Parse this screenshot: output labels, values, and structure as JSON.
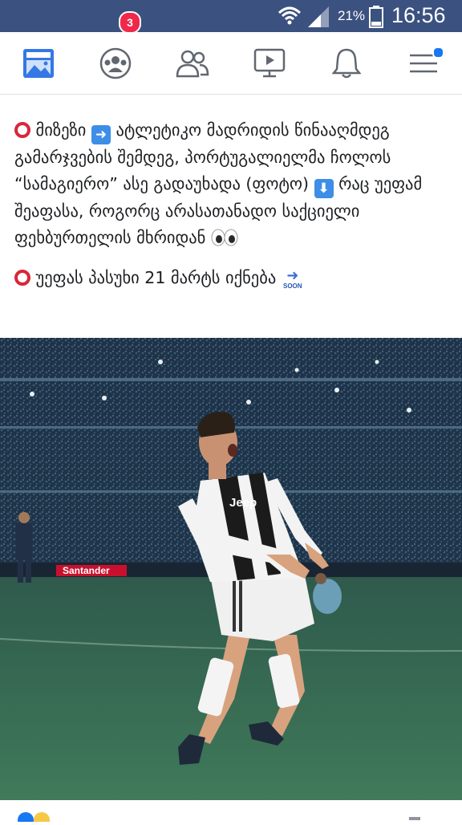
{
  "status_bar": {
    "battery": "21%",
    "time": "16:56"
  },
  "nav": {
    "items": [
      {
        "name": "news-feed"
      },
      {
        "name": "groups",
        "badge": "3"
      },
      {
        "name": "friends"
      },
      {
        "name": "watch"
      },
      {
        "name": "notifications"
      },
      {
        "name": "menu"
      }
    ]
  },
  "post": {
    "line1_a": "მიზეზი",
    "line1_b": "ატლეტიკო მადრიდის წინააღმდეგ გამარჯვების შემდეგ, პორტუგალიელმა ჩოლოს “სამაგიერო” ასე გადაუხადა (ფოტო)",
    "line1_c": "რაც უეფამ შეაფასა, როგორც არასათანადო საქციელი ფეხბურთელის მხრიდან",
    "line2": "უეფას პასუხი 21 მარტს იქნება",
    "soon": "SOON"
  },
  "photo": {
    "ad_board": "Santander",
    "jersey": "Jeep"
  },
  "colors": {
    "status_bar": "#3b5180",
    "badge": "#f02849",
    "accent": "#1877f2"
  }
}
